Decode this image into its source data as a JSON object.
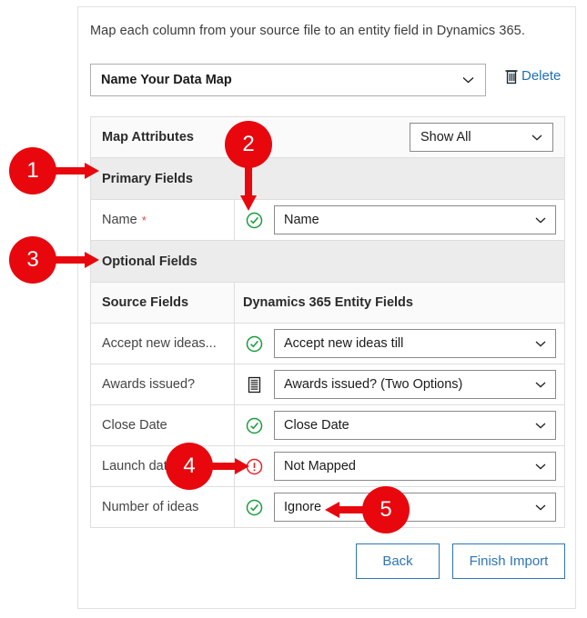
{
  "intro": "Map each column from your source file to an entity field in Dynamics 365.",
  "map_name": {
    "value": "Name Your Data Map",
    "chevron_icon": "chevron-down-icon"
  },
  "delete": {
    "label": "Delete",
    "icon": "trash-icon"
  },
  "table": {
    "attributes_header": {
      "label": "Map Attributes",
      "filter_value": "Show All",
      "filter_icon": "chevron-down-icon"
    },
    "sections": {
      "primary": "Primary Fields",
      "optional": "Optional Fields"
    },
    "column_headers": {
      "source": "Source Fields",
      "target": "Dynamics 365 Entity Fields"
    },
    "primary_rows": [
      {
        "source": "Name",
        "required": "*",
        "status_icon": "check-circle-icon",
        "status": "mapped",
        "target": "Name"
      }
    ],
    "optional_rows": [
      {
        "source": "Accept new ideas...",
        "status_icon": "check-circle-icon",
        "status": "mapped",
        "target": "Accept new ideas till"
      },
      {
        "source": "Awards issued?",
        "status_icon": "list-document-icon",
        "status": "option-set",
        "target": "Awards issued? (Two Options)"
      },
      {
        "source": "Close Date",
        "status_icon": "check-circle-icon",
        "status": "mapped",
        "target": "Close Date"
      },
      {
        "source": "Launch date",
        "status_icon": "error-circle-icon",
        "status": "error",
        "target": "Not Mapped"
      },
      {
        "source": "Number of ideas",
        "status_icon": "check-circle-icon",
        "status": "mapped",
        "target": "Ignore"
      }
    ]
  },
  "footer": {
    "back_label": "Back",
    "finish_label": "Finish Import"
  },
  "callouts": [
    {
      "number": "1",
      "points_to": "primary-fields-section"
    },
    {
      "number": "2",
      "points_to": "name-row-status-icon"
    },
    {
      "number": "3",
      "points_to": "optional-fields-section"
    },
    {
      "number": "4",
      "points_to": "launch-date-error-icon"
    },
    {
      "number": "5",
      "points_to": "number-of-ideas-target"
    }
  ],
  "colors": {
    "callout_red": "#e8070d",
    "link_blue": "#1f6fb2",
    "button_blue": "#2e75b6",
    "success_green": "#199b3d",
    "error_red": "#e0262b",
    "required_red": "#e04646"
  }
}
